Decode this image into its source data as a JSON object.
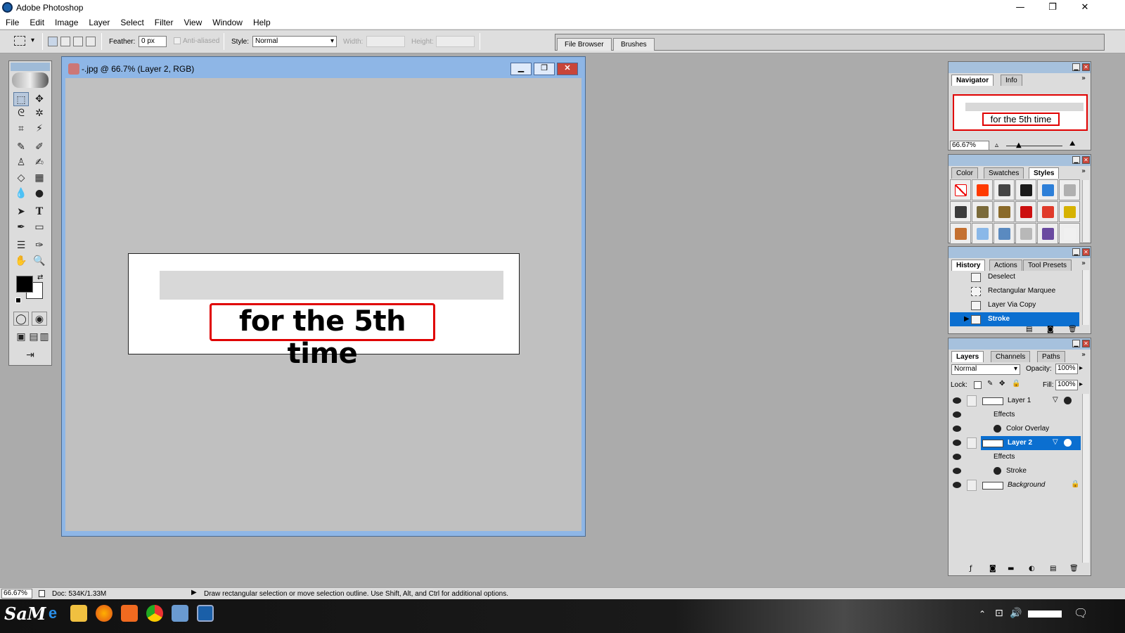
{
  "window": {
    "title": "Adobe Photoshop",
    "minimize": "—",
    "restore": "❐",
    "close": "✕"
  },
  "menu": [
    "File",
    "Edit",
    "Image",
    "Layer",
    "Select",
    "Filter",
    "View",
    "Window",
    "Help"
  ],
  "options": {
    "feather_label": "Feather:",
    "feather_value": "0 px",
    "anti_aliased_label": "Anti-aliased",
    "style_label": "Style:",
    "style_value": "Normal",
    "width_label": "Width:",
    "height_label": "Height:",
    "well_tabs": [
      "File Browser",
      "Brushes"
    ]
  },
  "document": {
    "title": "-.jpg @ 66.7% (Layer 2, RGB)",
    "canvas_text": "for the 5th time"
  },
  "navigator": {
    "tabs": [
      "Navigator",
      "Info"
    ],
    "preview_text": "for the 5th time",
    "zoom": "66.67%"
  },
  "styles_panel": {
    "tabs": [
      "Color",
      "Swatches",
      "Styles"
    ],
    "swatches": [
      "#ffffff",
      "#ff3a00",
      "#444444",
      "#1b1b1b",
      "#2d7fd8",
      "#b0b0b0",
      "#3b3b3b",
      "#7a6a3a",
      "#8a6a2a",
      "#cc1010",
      "#e03a2a",
      "#d6b200",
      "#c47030",
      "#8ab8e8",
      "#5a8ac0",
      "#b8b8b8",
      "#6a4aa0",
      "#f0f0f0"
    ]
  },
  "history": {
    "tabs": [
      "History",
      "Actions",
      "Tool Presets"
    ],
    "items": [
      "Deselect",
      "Rectangular Marquee",
      "Layer Via Copy",
      "Stroke"
    ]
  },
  "layers": {
    "tabs": [
      "Layers",
      "Channels",
      "Paths"
    ],
    "blend_mode": "Normal",
    "opacity_label": "Opacity:",
    "opacity": "100%",
    "lock_label": "Lock:",
    "fill_label": "Fill:",
    "fill": "100%",
    "rows": [
      {
        "name": "Layer 1",
        "kind": "layer"
      },
      {
        "name": "Effects",
        "kind": "effects"
      },
      {
        "name": "Color Overlay",
        "kind": "effect"
      },
      {
        "name": "Layer 2",
        "kind": "layer",
        "selected": true
      },
      {
        "name": "Effects",
        "kind": "effects"
      },
      {
        "name": "Stroke",
        "kind": "effect"
      },
      {
        "name": "Background",
        "kind": "background"
      }
    ]
  },
  "status": {
    "zoom": "66.67%",
    "doc": "Doc: 534K/1.33M",
    "hint": "Draw rectangular selection or move selection outline.  Use Shift, Alt, and Ctrl for additional options."
  },
  "taskbar": {
    "logo": "SaM"
  },
  "colors": {
    "selection": "#0b6fd0",
    "stroke_red": "#e00000",
    "panel_bg": "#dcdcdc",
    "app_bg": "#ababab"
  }
}
